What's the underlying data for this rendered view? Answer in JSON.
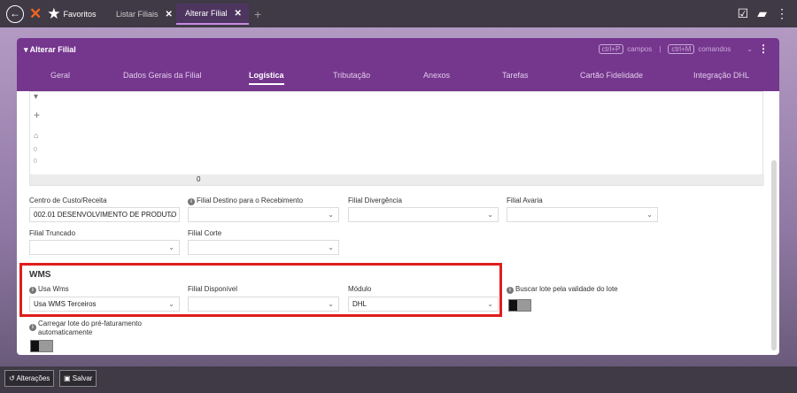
{
  "topbar": {
    "back_icon": "arrow-left-circle-icon",
    "logo_symbol": "✕",
    "favorites_label": "Favoritos",
    "tabs": [
      {
        "label": "Listar Filiais",
        "close": "✕"
      },
      {
        "label": "Alterar Filial",
        "close": "✕"
      }
    ],
    "add_tab": "+"
  },
  "panel": {
    "title": "▾ Alterar Filial",
    "shortcut1_key": "ctrl+P",
    "shortcut1_label": "campos",
    "separator": "|",
    "shortcut2_key": "ctrl+M",
    "shortcut2_label": "comandos",
    "tabs": [
      "Geral",
      "Dados Gerais da Filial",
      "Logística",
      "Tributação",
      "Anexos",
      "Tarefas",
      "Cartão Fidelidade",
      "Integração DHL"
    ],
    "active_tab": "Logística"
  },
  "grid": {
    "tools": [
      "▾",
      "+",
      "🗑",
      "0",
      "0"
    ],
    "footer_value": "0"
  },
  "fields": {
    "centro_custo": {
      "label": "Centro de Custo/Receita",
      "value": "002.01 DESENVOLVIMENTO DE PRODUTO"
    },
    "filial_destino": {
      "label": "Filial Destino para o Recebimento",
      "value": ""
    },
    "filial_divergencia": {
      "label": "Filial Divergência",
      "value": ""
    },
    "filial_avaria": {
      "label": "Filial Avaria",
      "value": ""
    },
    "filial_truncado": {
      "label": "Filial Truncado",
      "value": ""
    },
    "filial_corte": {
      "label": "Filial Corte",
      "value": ""
    }
  },
  "wms": {
    "title": "WMS",
    "usa_wms": {
      "label": "Usa Wms",
      "value": "Usa WMS Terceiros"
    },
    "filial_disponivel": {
      "label": "Filial Disponível",
      "value": ""
    },
    "modulo": {
      "label": "Módulo",
      "value": "DHL"
    },
    "buscar_lote": {
      "label": "Buscar lote pela validade do lote",
      "on": false
    },
    "carregar_lote": {
      "label_line1": "Carregar lote do pré-faturamento",
      "label_line2": "automaticamente",
      "on": false
    }
  },
  "actions": {
    "alteracoes": "Alterações",
    "salvar": "Salvar"
  },
  "colors": {
    "header_purple": "#75368e",
    "highlight_red": "#e01d1d",
    "logo_orange": "#f26522"
  }
}
